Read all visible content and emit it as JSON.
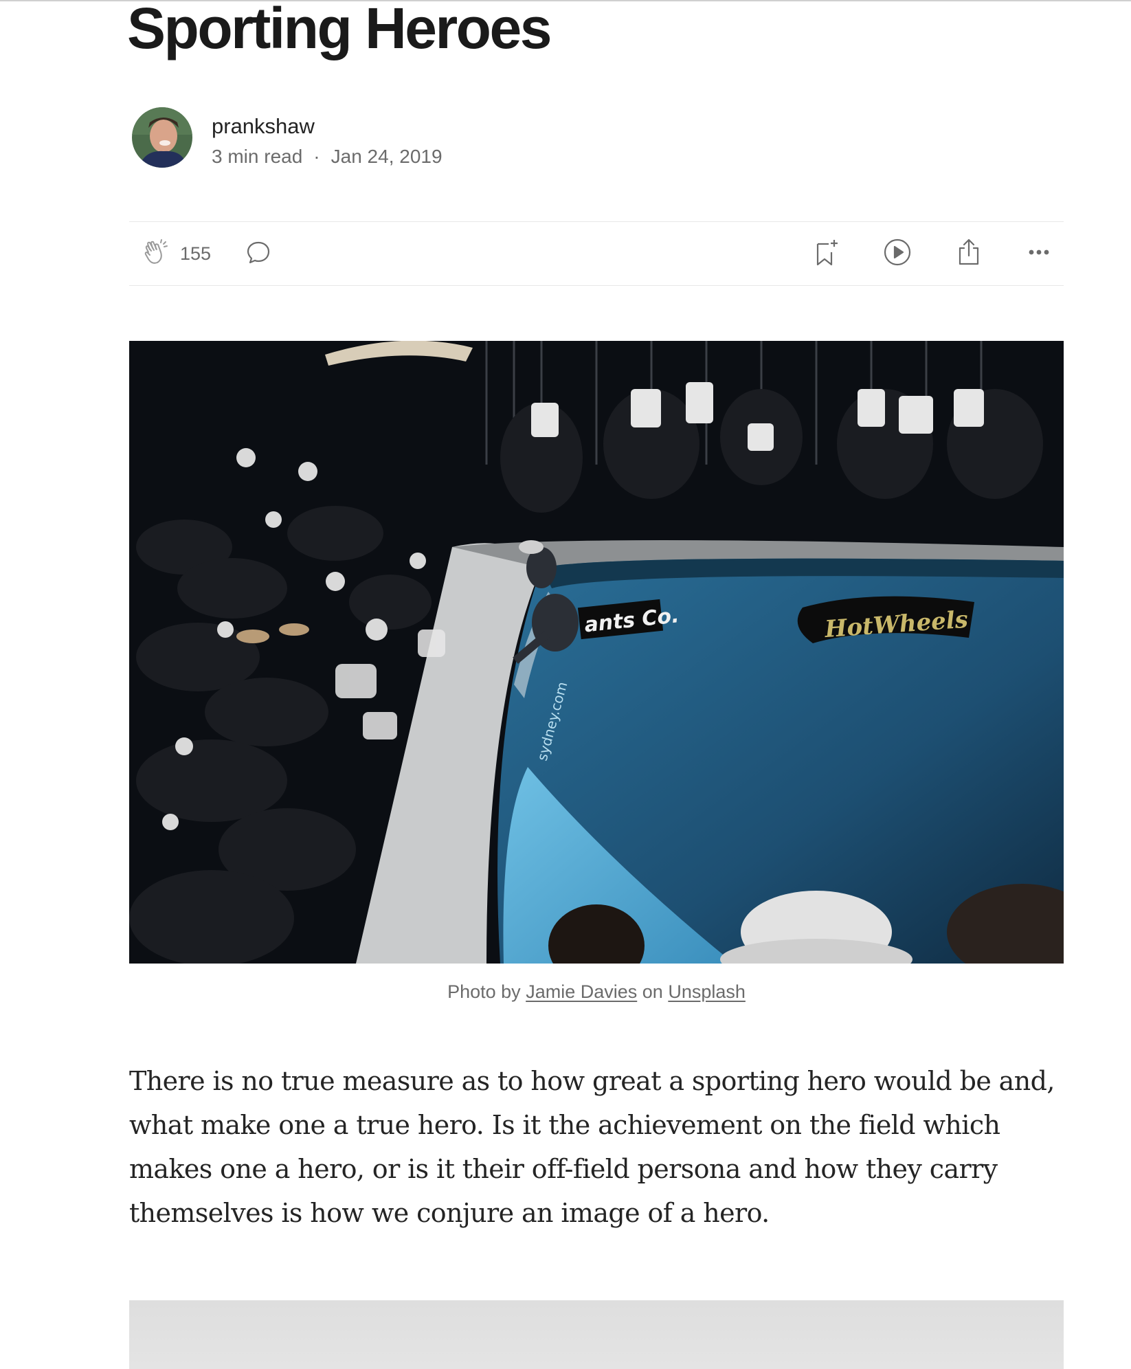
{
  "article": {
    "title": "Sporting Heroes",
    "author": {
      "name": "prankshaw",
      "read_time": "3 min read",
      "separator": "·",
      "date": "Jan 24, 2019"
    },
    "actions": {
      "clap_count": "155",
      "icons": [
        "clap-icon",
        "comment-icon",
        "bookmark-icon",
        "listen-icon",
        "share-icon",
        "more-icon"
      ]
    },
    "image": {
      "caption_prefix": "Photo by",
      "photographer": "Jamie Davies",
      "caption_mid": "on",
      "source": "Unsplash",
      "sign_left": "ants Co.",
      "sign_right": "HotWheels",
      "sign_wall": "sydney.com"
    },
    "paragraph": "There is no true measure as to how great a sporting hero would be and, what make one a true hero. Is it the achievement on the field which makes one a hero, or is it their off-field persona and how they carry themselves is how we conjure an image of a hero."
  },
  "colors": {
    "text": "#242424",
    "muted": "#6b6b6b",
    "divider": "#e8e8e8",
    "pool_blue": "#1f5f86"
  }
}
